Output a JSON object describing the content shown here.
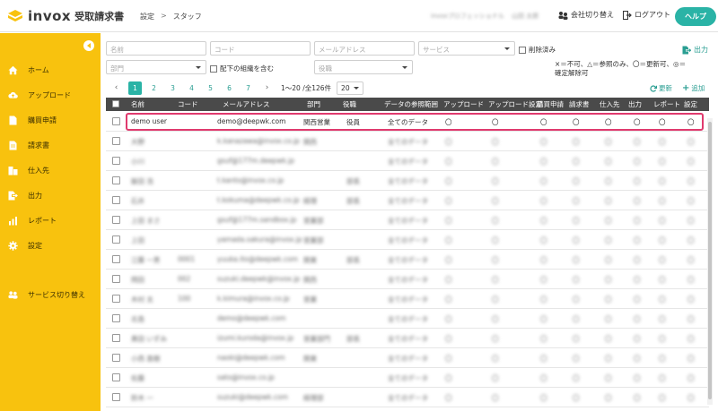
{
  "header": {
    "app_name": "invox",
    "app_sub": "受取請求書",
    "breadcrumb": [
      "設定",
      "スタッフ"
    ],
    "breadcrumb_sep": ">",
    "company": "invoxプロフェッショナル",
    "user": "山田 太郎",
    "switch_company": "会社切り替え",
    "logout": "ログアウト",
    "help": "ヘルプ"
  },
  "sidebar": {
    "items": [
      {
        "label": "ホーム",
        "icon": "home-icon"
      },
      {
        "label": "アップロード",
        "icon": "cloud-upload-icon"
      },
      {
        "label": "購買申請",
        "icon": "document-icon"
      },
      {
        "label": "請求書",
        "icon": "invoice-icon"
      },
      {
        "label": "仕入先",
        "icon": "building-icon"
      },
      {
        "label": "出力",
        "icon": "export-icon"
      },
      {
        "label": "レポート",
        "icon": "bar-chart-icon"
      },
      {
        "label": "設定",
        "icon": "gear-icon"
      }
    ],
    "service_switch": "サービス切り替え"
  },
  "filters": {
    "name_placeholder": "名前",
    "code_placeholder": "コード",
    "email_placeholder": "メールアドレス",
    "service_placeholder": "サービス",
    "deleted_label": "削除済み",
    "dept_placeholder": "部門",
    "include_sub_label": "配下の組織を含む",
    "role_placeholder": "役職",
    "export_label": "出力"
  },
  "legend": "×＝不可、△＝参照のみ、〇＝更新可、◎＝確定解除可",
  "pager": {
    "pages": [
      "1",
      "2",
      "3",
      "4",
      "5",
      "6",
      "7"
    ],
    "current": "1",
    "prev": "‹",
    "next": "›",
    "range": "1〜20 /全126件",
    "per_page": "20",
    "refresh": "更新",
    "add": "追加"
  },
  "table": {
    "headers": [
      "名前",
      "コード",
      "メールアドレス",
      "部門",
      "役職",
      "データの参照範囲",
      "アップロード",
      "アップロード設定",
      "購買申請",
      "請求書",
      "仕入先",
      "出力",
      "レポート",
      "設定"
    ],
    "first_row": {
      "name": "demo user",
      "code": "",
      "email": "demo@deepwk.com",
      "dept": "関西営業",
      "role": "役員",
      "scope": "全てのデータ",
      "perms": [
        "〇",
        "〇",
        "〇",
        "〇",
        "〇",
        "〇",
        "〇",
        "〇"
      ]
    },
    "blurred_rows": [
      {
        "name": "大野",
        "code": "",
        "email": "k.kanazawa@invox.co.jp",
        "dept": "関西",
        "role": "",
        "scope": "全てのデータ"
      },
      {
        "name": "小川",
        "code": "",
        "email": "gsuf@177m.deepwk.jp",
        "dept": "",
        "role": "",
        "scope": "全てのデータ"
      },
      {
        "name": "飯田 浩",
        "code": "",
        "email": "t.kanto@invox.co.jp",
        "dept": "",
        "role": "部長",
        "scope": "全てのデータ"
      },
      {
        "name": "石井",
        "code": "",
        "email": "t.kokuma@deepwk.co.jp",
        "dept": "経理",
        "role": "部長",
        "scope": "全てのデータ"
      },
      {
        "name": "上田 まさ",
        "code": "",
        "email": "gsuf@177m.sandbox.jp",
        "dept": "営業部",
        "role": "",
        "scope": "全てのデータ"
      },
      {
        "name": "上田",
        "code": "",
        "email": "yamada.sakura@invox.jp",
        "dept": "営業部",
        "role": "",
        "scope": "全てのデータ"
      },
      {
        "name": "江藤 一男",
        "code": "0001",
        "email": "yuuka.ito@deepwk.com",
        "dept": "関東",
        "role": "部長",
        "scope": "全てのデータ"
      },
      {
        "name": "岡田",
        "code": "002",
        "email": "suzuki.deepwk@invox.jp",
        "dept": "関西",
        "role": "",
        "scope": "全てのデータ"
      },
      {
        "name": "木村 太",
        "code": "100",
        "email": "k.kimura@invox.co.jp",
        "dept": "営業",
        "role": "",
        "scope": "全てのデータ"
      },
      {
        "name": "北島",
        "code": "",
        "email": "demo@deepwk.com",
        "dept": "",
        "role": "",
        "scope": "全てのデータ"
      },
      {
        "name": "黒田 いずみ",
        "code": "",
        "email": "izumi.kuroda@invox.jp",
        "dept": "営業部門",
        "role": "部長",
        "scope": "全てのデータ"
      },
      {
        "name": "小西 直樹",
        "code": "",
        "email": "naoki@deepwk.com",
        "dept": "関東",
        "role": "",
        "scope": "全てのデータ"
      },
      {
        "name": "佐藤",
        "code": "",
        "email": "sato@invox.co.jp",
        "dept": "",
        "role": "",
        "scope": "全てのデータ"
      },
      {
        "name": "鈴木 一",
        "code": "",
        "email": "suzuki@deepwk.com",
        "dept": "経理部",
        "role": "",
        "scope": "全てのデータ"
      }
    ]
  }
}
